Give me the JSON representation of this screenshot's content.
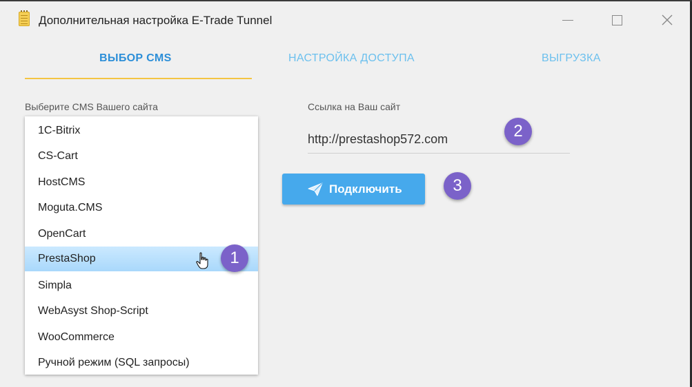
{
  "window": {
    "title": "Дополнительная настройка E-Trade Tunnel",
    "icon": "notepad-icon"
  },
  "tabs": [
    {
      "label": "ВЫБОР CMS",
      "active": true
    },
    {
      "label": "НАСТРОЙКА ДОСТУПА",
      "active": false
    },
    {
      "label": "ВЫГРУЗКА",
      "active": false
    }
  ],
  "cms": {
    "label": "Выберите CMS Вашего сайта",
    "selected": "PrestaShop",
    "options": [
      "1C-Bitrix",
      "CS-Cart",
      "HostCMS",
      "Moguta.CMS",
      "OpenCart",
      "PrestaShop",
      "Simpla",
      "WebAsyst Shop-Script",
      "WooCommerce",
      "Ручной режим (SQL запросы)"
    ]
  },
  "site": {
    "label": "Ссылка на Ваш сайт",
    "url": "http://prestashop572.com"
  },
  "connect": {
    "label": "Подключить"
  },
  "badges": [
    "1",
    "2",
    "3"
  ],
  "colors": {
    "accent": "#2d8fd8",
    "tab_inactive": "#6cc0ee",
    "underline": "#f4c542",
    "button": "#46a9ec",
    "badge": "#7b62c9",
    "selected_row": "#b3ddfc"
  }
}
